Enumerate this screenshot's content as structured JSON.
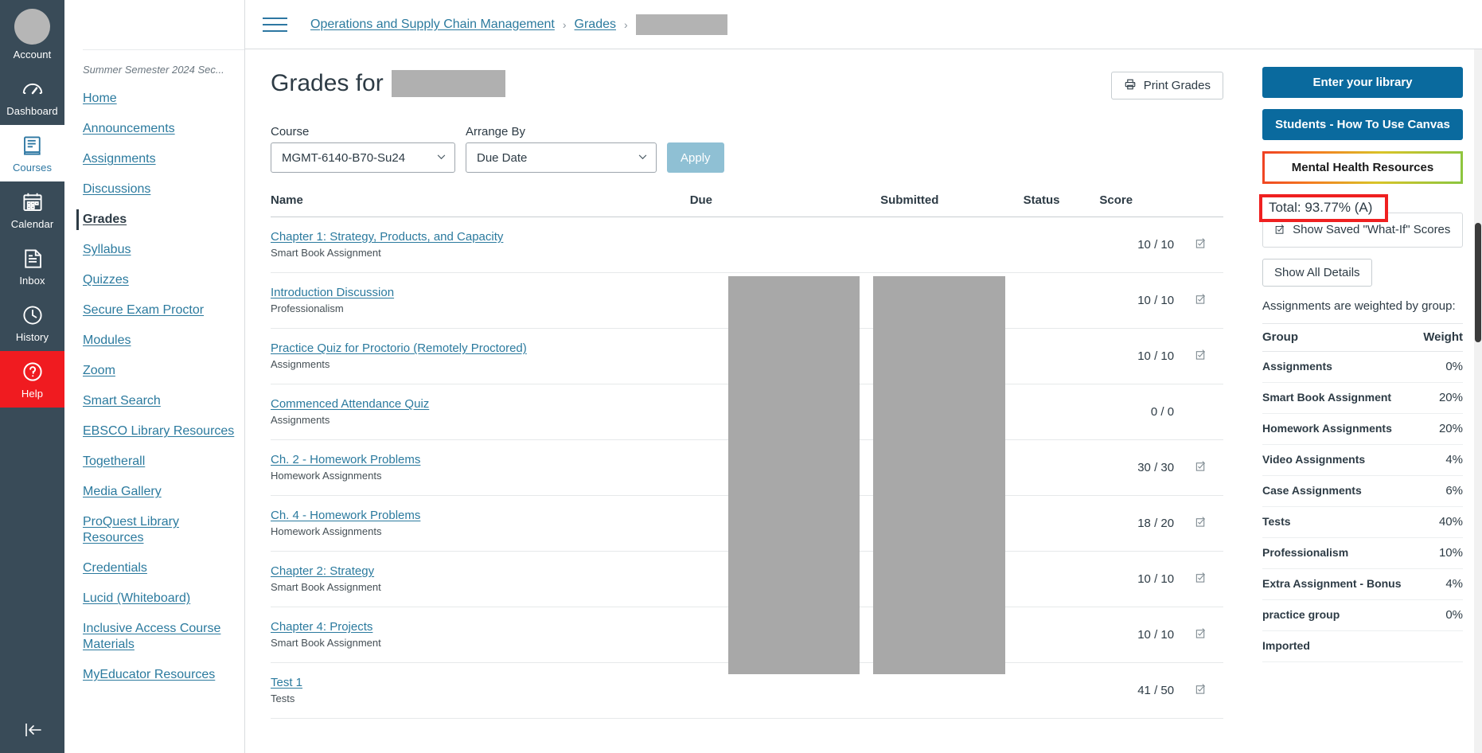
{
  "global_nav": {
    "items": [
      {
        "label": "Account",
        "icon": "avatar-icon",
        "active": false
      },
      {
        "label": "Dashboard",
        "icon": "dashboard-icon",
        "active": false
      },
      {
        "label": "Courses",
        "icon": "courses-icon",
        "active": true
      },
      {
        "label": "Calendar",
        "icon": "calendar-icon",
        "active": false
      },
      {
        "label": "Inbox",
        "icon": "inbox-icon",
        "active": false
      },
      {
        "label": "History",
        "icon": "history-clock-icon",
        "active": false
      },
      {
        "label": "Help",
        "icon": "help-question-icon",
        "active": false
      }
    ],
    "collapse_icon": "collapse-left-arrow-icon"
  },
  "course_nav": {
    "term": "Summer Semester 2024 Sec...",
    "items": [
      {
        "label": "Home",
        "active": false
      },
      {
        "label": "Announcements",
        "active": false
      },
      {
        "label": "Assignments",
        "active": false
      },
      {
        "label": "Discussions",
        "active": false
      },
      {
        "label": "Grades",
        "active": true
      },
      {
        "label": "Syllabus",
        "active": false
      },
      {
        "label": "Quizzes",
        "active": false
      },
      {
        "label": "Secure Exam Proctor",
        "active": false
      },
      {
        "label": "Modules",
        "active": false
      },
      {
        "label": "Zoom",
        "active": false
      },
      {
        "label": "Smart Search",
        "active": false
      },
      {
        "label": "EBSCO Library Resources",
        "active": false
      },
      {
        "label": "Togetherall",
        "active": false
      },
      {
        "label": "Media Gallery",
        "active": false
      },
      {
        "label": "ProQuest Library Resources",
        "active": false
      },
      {
        "label": "Credentials",
        "active": false
      },
      {
        "label": "Lucid (Whiteboard)",
        "active": false
      },
      {
        "label": "Inclusive Access Course Materials",
        "active": false
      },
      {
        "label": "MyEducator Resources",
        "active": false
      }
    ]
  },
  "breadcrumb": {
    "menu_icon": "hamburger-menu-icon",
    "items": [
      {
        "label": "Operations and Supply Chain Management",
        "redacted": false
      },
      {
        "label": "Grades",
        "redacted": false
      },
      {
        "label": "",
        "redacted": true
      }
    ],
    "separator": "›"
  },
  "page": {
    "title_prefix": "Grades for",
    "title_redacted": true,
    "print_button": {
      "label": "Print Grades",
      "icon": "printer-icon"
    }
  },
  "filters": {
    "course": {
      "label": "Course",
      "value": "MGMT-6140-B70-Su24"
    },
    "arrange_by": {
      "label": "Arrange By",
      "value": "Due Date"
    },
    "apply_button": "Apply"
  },
  "grades_table": {
    "headers": [
      "Name",
      "Due",
      "Submitted",
      "Status",
      "Score",
      ""
    ],
    "rows": [
      {
        "name": "Chapter 1: Strategy, Products, and Capacity",
        "group": "Smart Book Assignment",
        "due": "",
        "submitted": "",
        "status": "",
        "score": "10 / 10",
        "has_whatif_icon": true
      },
      {
        "name": "Introduction Discussion",
        "group": "Professionalism",
        "due": "",
        "submitted": "",
        "status": "",
        "score": "10 / 10",
        "has_whatif_icon": true
      },
      {
        "name": "Practice Quiz for Proctorio (Remotely Proctored)",
        "group": "Assignments",
        "due": "",
        "submitted": "",
        "status": "",
        "score": "10 / 10",
        "has_whatif_icon": true
      },
      {
        "name": "Commenced Attendance Quiz",
        "group": "Assignments",
        "due": "",
        "submitted": "",
        "status": "",
        "score": "0 / 0",
        "has_whatif_icon": false
      },
      {
        "name": "Ch. 2 - Homework Problems",
        "group": "Homework Assignments",
        "due": "",
        "submitted": "",
        "status": "",
        "score": "30 / 30",
        "has_whatif_icon": true
      },
      {
        "name": "Ch. 4 - Homework Problems",
        "group": "Homework Assignments",
        "due": "",
        "submitted": "",
        "status": "",
        "score": "18 / 20",
        "has_whatif_icon": true
      },
      {
        "name": "Chapter 2: Strategy",
        "group": "Smart Book Assignment",
        "due": "",
        "submitted": "",
        "status": "",
        "score": "10 / 10",
        "has_whatif_icon": true
      },
      {
        "name": "Chapter 4: Projects",
        "group": "Smart Book Assignment",
        "due": "",
        "submitted": "",
        "status": "",
        "score": "10 / 10",
        "has_whatif_icon": true
      },
      {
        "name": "Test 1",
        "group": "Tests",
        "due": "",
        "submitted": "",
        "status": "",
        "score": "41 / 50",
        "has_whatif_icon": true
      }
    ]
  },
  "sidebar": {
    "buttons": [
      {
        "label": "Enter your library",
        "style": "blue"
      },
      {
        "label": "Students - How To Use Canvas",
        "style": "blue"
      },
      {
        "label": "Mental Health Resources",
        "style": "gradient-outline"
      }
    ],
    "total": "Total: 93.77% (A)",
    "total_highlight_color": "#ef2020",
    "what_if": {
      "label": "Show Saved \"What-If\" Scores",
      "icon": "whatif-pencil-checkbox-icon"
    },
    "show_all_details": "Show All Details",
    "weight_note": "Assignments are weighted by group:",
    "weights_headers": [
      "Group",
      "Weight"
    ],
    "weights": [
      {
        "group": "Assignments",
        "weight": "0%"
      },
      {
        "group": "Smart Book Assignment",
        "weight": "20%"
      },
      {
        "group": "Homework Assignments",
        "weight": "20%"
      },
      {
        "group": "Video Assignments",
        "weight": "4%"
      },
      {
        "group": "Case Assignments",
        "weight": "6%"
      },
      {
        "group": "Tests",
        "weight": "40%"
      },
      {
        "group": "Professionalism",
        "weight": "10%"
      },
      {
        "group": "Extra Assignment - Bonus",
        "weight": "4%"
      },
      {
        "group": "practice group",
        "weight": "0%"
      },
      {
        "group": "Imported",
        "weight": ""
      }
    ]
  },
  "colors": {
    "global_nav_bg": "#394b58",
    "help_red": "#f01b20",
    "link_blue": "#2b7a9e",
    "button_blue": "#0a6a9e",
    "apply_blue": "#8fc0d4",
    "redaction_gray": "#a8a8a8"
  }
}
